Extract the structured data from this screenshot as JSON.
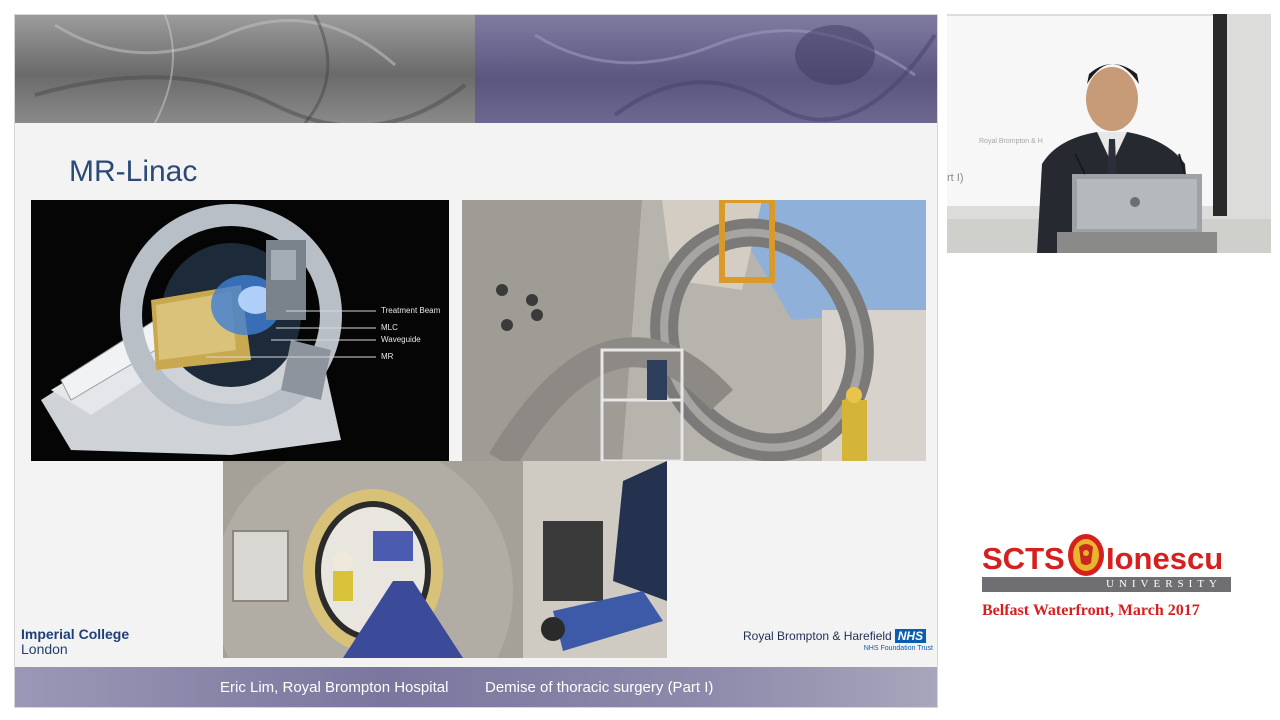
{
  "slide": {
    "title": "MR-Linac",
    "callouts": [
      "Treatment Beam",
      "MLC",
      "Waveguide",
      "MR"
    ],
    "logo_left": {
      "line1": "Imperial College",
      "line2": "London"
    },
    "logo_right": {
      "name": "Royal Brompton & Harefield",
      "badge": "NHS",
      "subtitle": "NHS Foundation Trust"
    },
    "footer": {
      "presenter": "Eric Lim, Royal Brompton Hospital",
      "talk": "Demise of thoracic surgery (Part I)"
    }
  },
  "video": {
    "screen_text": "Royal Brompton & H",
    "screen_caption": "rt I)"
  },
  "branding": {
    "left_word": "SCTS",
    "right_word": "Ionescu",
    "university": "UNIVERSITY",
    "event": "Belfast Waterfront, March 2017"
  },
  "colors": {
    "title_blue": "#2b4a78",
    "brand_red": "#d62020",
    "nhs_blue": "#0a5eb0"
  }
}
